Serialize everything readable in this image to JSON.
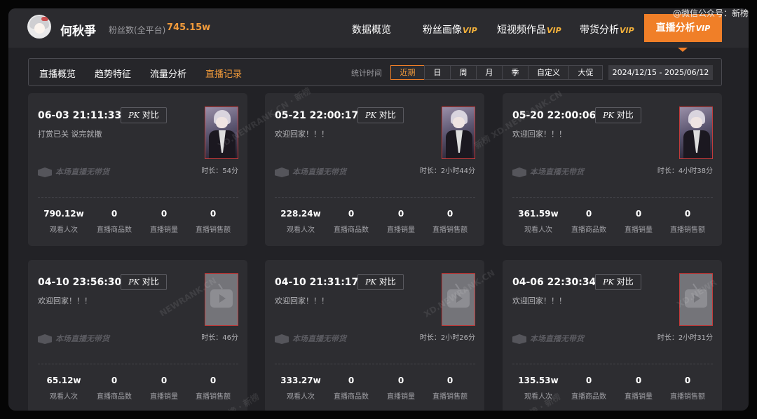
{
  "watermark": "@微信公众号：新榜",
  "profile": {
    "name": "何秋爭",
    "fans_label": "粉丝数(全平台)",
    "fans_value": "745.15w"
  },
  "nav": {
    "items": [
      {
        "label": "数据概览",
        "vip": ""
      },
      {
        "label": "粉丝画像",
        "vip": "VIP"
      },
      {
        "label": "短视频作品",
        "vip": "VIP"
      },
      {
        "label": "带货分析",
        "vip": "VIP"
      }
    ],
    "active": {
      "label": "直播分析",
      "vip": "VIP"
    }
  },
  "subnav": {
    "tabs": [
      "直播概览",
      "趋势特征",
      "流量分析",
      "直播记录"
    ],
    "active_tab": "直播记录",
    "stat_label": "统计时间",
    "periods": [
      "近期",
      "日",
      "周",
      "月",
      "季",
      "自定义",
      "大促"
    ],
    "active_period": "近期",
    "date_range": "2024/12/15 - 2025/06/12"
  },
  "card_common": {
    "pk_prefix": "PK",
    "pk_label": "对比",
    "no_goods": "本场直播无带货",
    "duration_prefix": "时长：",
    "stat_labels": [
      "观看人次",
      "直播商品数",
      "直播销量",
      "直播销售额"
    ]
  },
  "cards": [
    {
      "date": "06-03 21:11:33",
      "title": "打赏已关 说完就撤",
      "duration": "54分",
      "cover": "photo",
      "stats": [
        "790.12w",
        "0",
        "0",
        "0"
      ]
    },
    {
      "date": "05-21 22:00:17",
      "title": "欢迎回家！！！",
      "duration": "2小时44分",
      "cover": "photo",
      "stats": [
        "228.24w",
        "0",
        "0",
        "0"
      ]
    },
    {
      "date": "05-20 22:00:06",
      "title": "欢迎回家！！！",
      "duration": "4小时38分",
      "cover": "photo",
      "stats": [
        "361.59w",
        "0",
        "0",
        "0"
      ]
    },
    {
      "date": "04-10 23:56:30",
      "title": "欢迎回家！！！",
      "duration": "46分",
      "cover": "placeholder",
      "stats": [
        "65.12w",
        "0",
        "0",
        "0"
      ]
    },
    {
      "date": "04-10 21:31:17",
      "title": "欢迎回家！！！",
      "duration": "2小时26分",
      "cover": "placeholder",
      "stats": [
        "333.27w",
        "0",
        "0",
        "0"
      ]
    },
    {
      "date": "04-06 22:30:34",
      "title": "欢迎回家！！！",
      "duration": "2小时31分",
      "cover": "placeholder",
      "stats": [
        "135.53w",
        "0",
        "0",
        "0"
      ]
    }
  ],
  "icons": {
    "cover_placeholder": "tv-play-icon",
    "no_goods": "box-icon",
    "avatar": "avatar-icon"
  },
  "colors": {
    "accent": "#f07f28",
    "vip": "#f2b03b",
    "fans_value": "#f29b3b"
  }
}
